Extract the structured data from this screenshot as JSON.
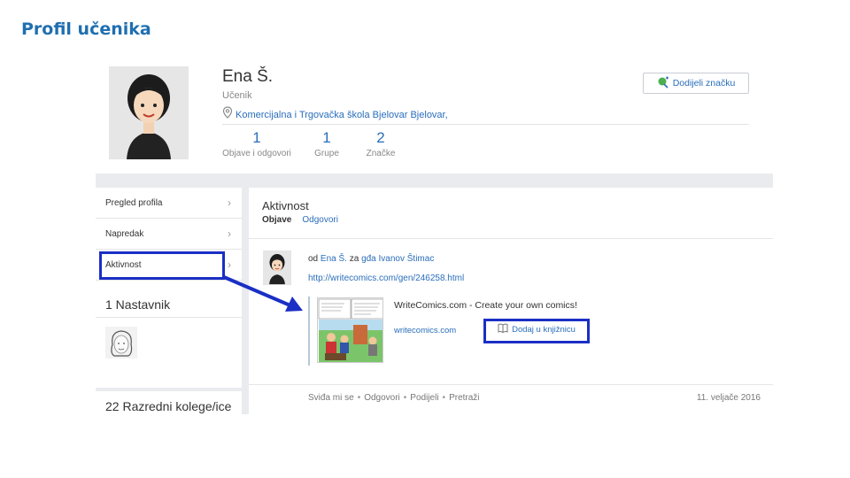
{
  "slide_title": "Profil učenika",
  "profile": {
    "name": "Ena Š.",
    "role": "Učenik",
    "school": "Komercijalna i Trgovačka škola Bjelovar Bjelovar,",
    "award_badge_button": "Dodijeli značku",
    "stats": [
      {
        "value": "1",
        "label": "Objave i odgovori"
      },
      {
        "value": "1",
        "label": "Grupe"
      },
      {
        "value": "2",
        "label": "Značke"
      }
    ]
  },
  "sidebar": {
    "items": [
      {
        "label": "Pregled profila"
      },
      {
        "label": "Napredak"
      },
      {
        "label": "Aktivnost"
      }
    ],
    "teachers_heading": "1 Nastavnik",
    "classmates_heading": "22 Razredni kolege/ice"
  },
  "activity": {
    "title": "Aktivnost",
    "tabs": {
      "active": "Objave",
      "other": "Odgovori"
    },
    "post": {
      "prefix": "od",
      "author": "Ena Š.",
      "middle": "za",
      "recipient": "gđa Ivanov Štimac",
      "url": "http://writecomics.com/gen/246258.html",
      "preview_title": "WriteComics.com - Create your own comics!",
      "preview_domain": "writecomics.com",
      "add_to_library": "Dodaj u knjižnicu",
      "actions": [
        "Sviđa mi se",
        "Odgovori",
        "Podijeli",
        "Pretraži"
      ],
      "separator": "•",
      "date": "11. veljače 2016"
    }
  },
  "colors": {
    "link": "#2a6ebb",
    "highlight": "#1a2fc4",
    "title": "#1f6fb0"
  },
  "icons": {
    "location": "location-pin-icon",
    "badge": "badge-icon",
    "library": "book-icon",
    "chevron": "chevron-right-icon"
  }
}
